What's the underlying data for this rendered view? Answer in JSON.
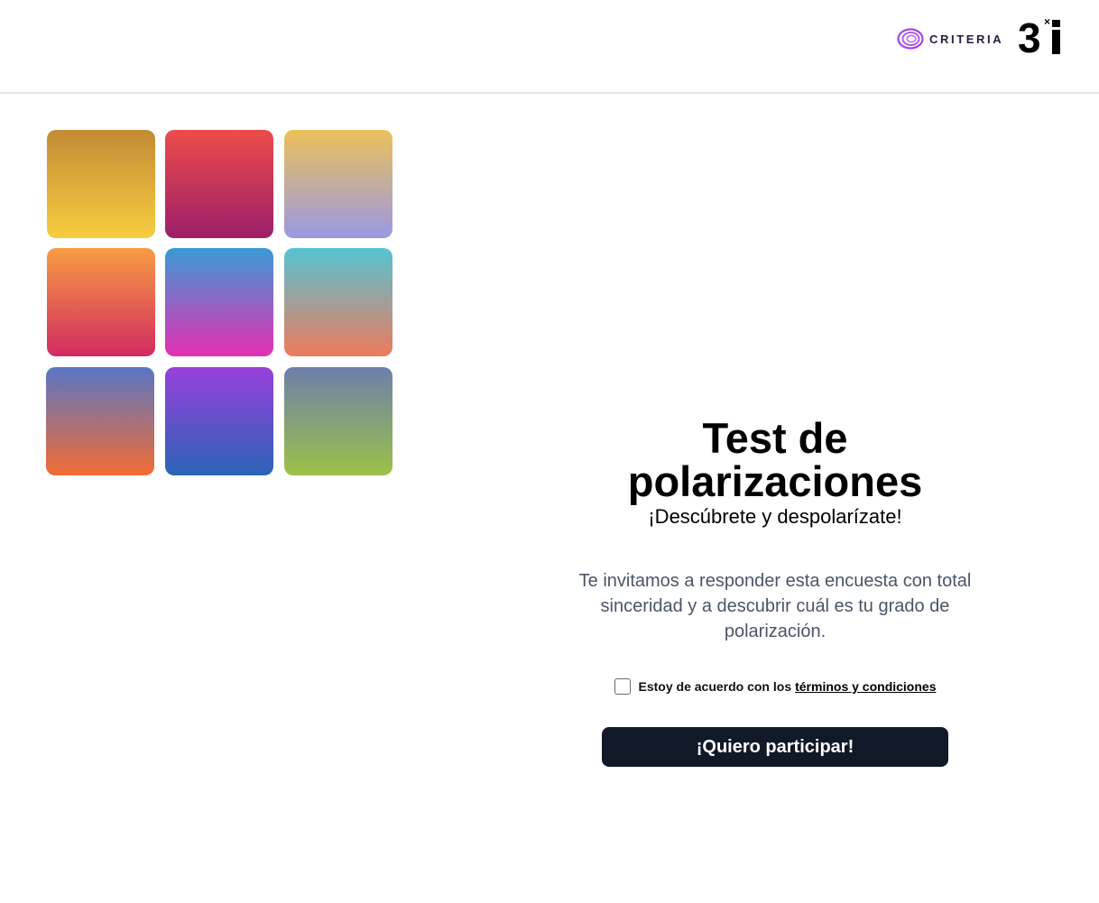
{
  "header": {
    "criteria_logo_text": "CRITERIA",
    "criteria_logo_icon": "spiral-logo-icon",
    "partner_logo_text": "3×i",
    "brand_purple": "#a145e8"
  },
  "tiles": [
    {
      "name": "gold-yellow"
    },
    {
      "name": "red-magenta"
    },
    {
      "name": "yellow-lavender"
    },
    {
      "name": "orange-pink"
    },
    {
      "name": "blue-pink"
    },
    {
      "name": "teal-coral"
    },
    {
      "name": "indigo-orange"
    },
    {
      "name": "purple-blue"
    },
    {
      "name": "slate-green"
    }
  ],
  "main": {
    "title": "Test de polarizaciones",
    "subtitle": "¡Descúbrete y despolarízate!",
    "intro": "Te invitamos a responder esta encuesta con total sinceridad y a descubrir cuál es tu grado de polarización.",
    "terms_prefix": "Estoy de acuerdo con los",
    "terms_link": "términos y condiciones",
    "terms_checked": false,
    "cta_label": "¡Quiero participar!",
    "cta_color": "#111827"
  }
}
